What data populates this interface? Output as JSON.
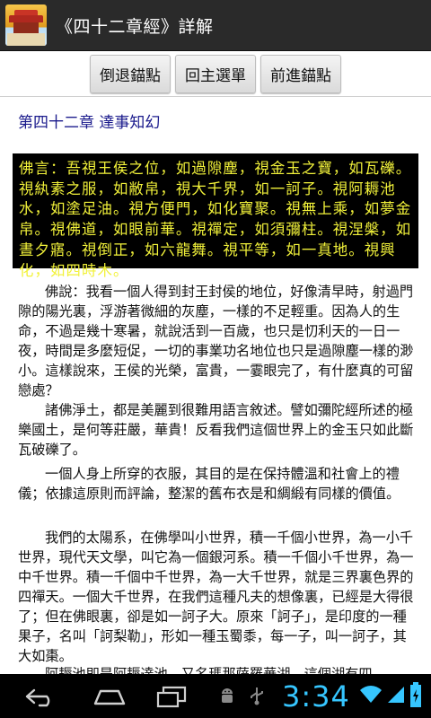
{
  "app": {
    "title": "《四十二章經》詳解"
  },
  "toolbar": {
    "back_label": "倒退錨點",
    "home_label": "回主選單",
    "forward_label": "前進錨點"
  },
  "content": {
    "chapter_title": "第四十二章 達事知幻",
    "sutra_text": "佛言：吾視王侯之位，如過隙塵，視金玉之寶，如瓦礫。視紈素之服，如敝帛，視大千界，如一訶子。視阿耨池水，如塗足油。視方便門，如化寶聚。視無上乘，如夢金帛。視佛道，如眼前華。視禪定，如須彌柱。視涅槃，如晝夕寤。視倒正，如六龍舞。視平等，如一真地。視興化，如四時木。",
    "paragraphs": [
      "佛說：我看一個人得到封王封侯的地位，好像清早時，射過門隙的陽光裏，浮游著微細的灰塵，一樣的不足輕重。因為人的生命，不過是幾十寒暑，就說活到一百歲，也只是忉利天的一日一夜，時間是多麼短促，一切的事業功名地位也只是過隙塵一樣的渺小。這樣說來，王侯的光榮，富貴，一霎眼完了，有什麼真的可留戀處？",
      "諸佛淨土，都是美麗到很難用語言敘述。譬如彌陀經所述的極樂國土，是何等莊嚴，華貴！反看我們這個世界上的金玉只如此斷瓦破礫了。",
      "一個人身上所穿的衣服，其目的是在保持體溫和社會上的禮儀；依據這原則而評論，整潔的舊布衣是和綢緞有同樣的價值。",
      "我們的太陽系，在佛學叫小世界，積一千個小世界，為一小千世界，現代天文學，叫它為一個銀河系。積一千個小千世界，為一中千世界。積一千個中千世界，為一大千世界，就是三界裏色界的四禪天。一個大千世界，在我們這種凡夫的想像裏，已經是大得很了；但在佛眼裏，卻是如一訶子大。原來「訶子」，是印度的一種果子，名叫「訶梨勒」，形如一種玉蜀黍，每一子，叫一訶子，其大如棗。",
      "阿耨池即是阿耨達池，又名瑪那薩羅華湖，這個湖有四"
    ]
  },
  "system_bar": {
    "clock": "3:34"
  },
  "icons": {
    "app_icon": "temple-icon",
    "nav_back": "back-arrow-icon",
    "nav_home": "home-icon",
    "nav_recent": "recent-apps-icon"
  },
  "colors": {
    "title_bar": "#2a2a2a",
    "chapter_title": "#1a1a8c",
    "sutra_box_bg": "#000000",
    "sutra_text": "#f2f23a",
    "clock": "#36c6ff"
  }
}
